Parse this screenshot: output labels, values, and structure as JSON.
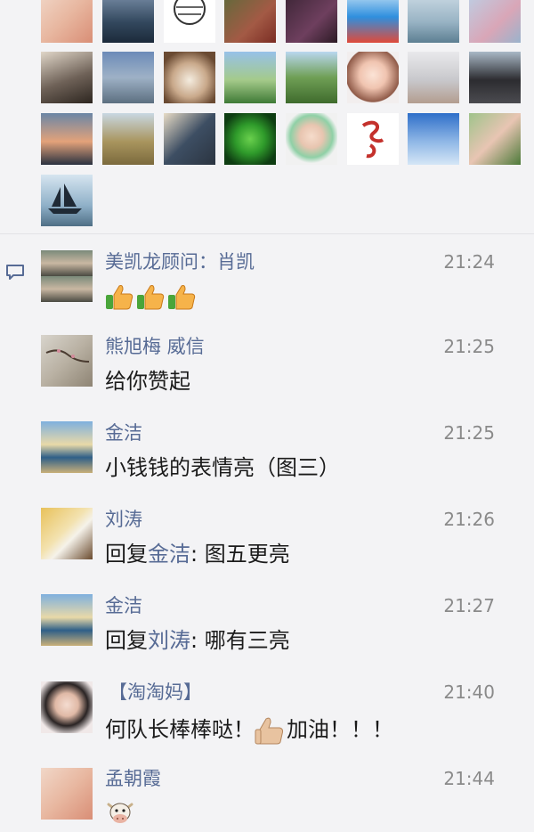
{
  "likes": {
    "avatars": [
      "avatar-mother-child",
      "avatar-warships",
      "avatar-sketch-head",
      "avatar-woman-red",
      "avatar-dark-purple",
      "avatar-doraemon",
      "avatar-lake-person",
      "avatar-blossom",
      "avatar-sunset-silhouette",
      "avatar-silver-car",
      "avatar-grumpy-cat",
      "avatar-lotus-pond",
      "avatar-green-field",
      "avatar-cartoon-girl",
      "avatar-woman-hat",
      "avatar-black-car",
      "avatar-dusk-sea",
      "avatar-hill-landscape",
      "avatar-man-desk",
      "avatar-clover",
      "avatar-baby",
      "avatar-calligraphy",
      "avatar-blue-sky",
      "avatar-child-park",
      "avatar-sailboat"
    ]
  },
  "comments": [
    {
      "name": "美凯龙顾问：肖凯",
      "time": "21:24",
      "text": "",
      "emoji": "thumbs-up x3"
    },
    {
      "name": "熊旭梅 威信",
      "time": "21:25",
      "text": "给你赞起"
    },
    {
      "name": "金洁",
      "time": "21:25",
      "text": "小钱钱的表情亮（图三）"
    },
    {
      "name": "刘涛",
      "time": "21:26",
      "reply_prefix": "回复",
      "reply_to": "金洁",
      "text": ": 图五更亮"
    },
    {
      "name": "金洁",
      "time": "21:27",
      "reply_prefix": "回复",
      "reply_to": "刘涛",
      "text": ": 哪有三亮"
    },
    {
      "name": "【淘淘妈】",
      "time": "21:40",
      "text_before": "何队长棒棒哒！",
      "text_after": "加油！！！"
    },
    {
      "name": "孟朝霞",
      "time": "21:44",
      "text": "",
      "emoji": "cow"
    }
  ]
}
